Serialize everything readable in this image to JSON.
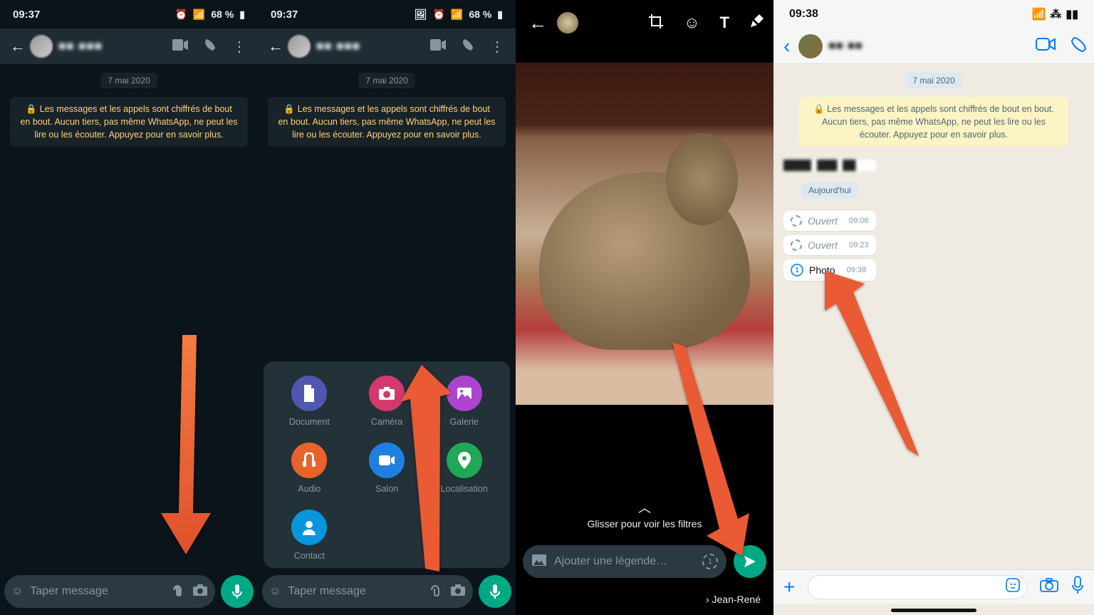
{
  "android": {
    "status": {
      "time": "09:37",
      "battery": "68 %",
      "icons": [
        "alarm",
        "nosim",
        "signal",
        "battery"
      ]
    },
    "chat": {
      "contact_blur": "■■   ■■■",
      "date_pill": "7 mai 2020",
      "encryption_notice": "Les messages et les appels sont chiffrés de bout en bout. Aucun tiers, pas même WhatsApp, ne peut les lire ou les écouter. Appuyez pour en savoir plus.",
      "input_placeholder": "Taper message"
    },
    "attach_sheet": {
      "items": [
        {
          "label": "Document"
        },
        {
          "label": "Caméra"
        },
        {
          "label": "Galerie"
        },
        {
          "label": "Audio"
        },
        {
          "label": "Salon"
        },
        {
          "label": "Localisation"
        },
        {
          "label": "Contact"
        }
      ]
    }
  },
  "editor": {
    "filters_hint": "Glisser pour voir les filtres",
    "caption_placeholder": "Ajouter une légende…",
    "recipient": "Jean-René"
  },
  "ios": {
    "status": {
      "time": "09:38"
    },
    "contact_blur": "■■  ■■",
    "date_pill": "7 mai 2020",
    "today_pill": "Aujourd'hui",
    "encryption_notice": "Les messages et les appels sont chiffrés de bout en bout. Aucun tiers, pas même WhatsApp, ne peut les lire ou les écouter. Appuyez pour en savoir plus.",
    "messages": [
      {
        "kind": "opened",
        "label": "Ouvert",
        "time": "09:06"
      },
      {
        "kind": "opened",
        "label": "Ouvert",
        "time": "09:23"
      },
      {
        "kind": "photo",
        "label": "Photo",
        "time": "09:38"
      }
    ]
  }
}
